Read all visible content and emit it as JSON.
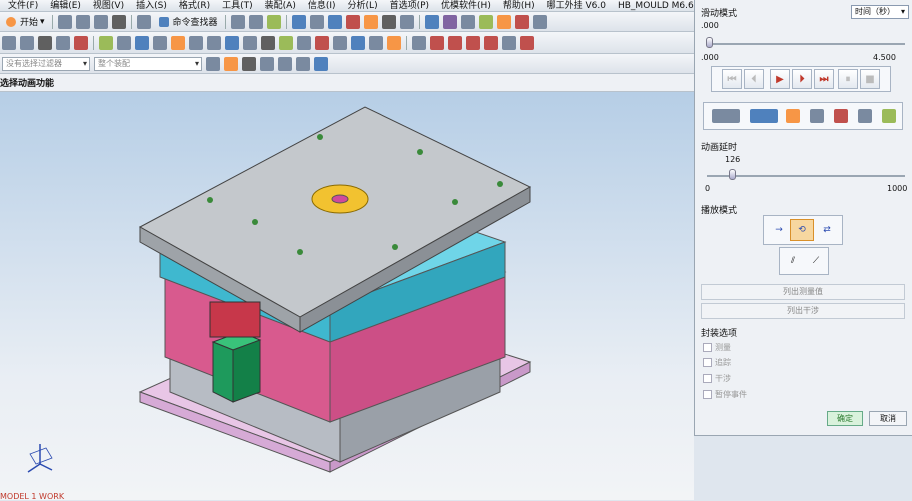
{
  "menu": [
    "文件(F)",
    "编辑(E)",
    "视图(V)",
    "插入(S)",
    "格式(R)",
    "工具(T)",
    "装配(A)",
    "信息(I)",
    "分析(L)",
    "首选项(P)",
    "优模软件(H)",
    "帮助(H)",
    "哪工外挂 V6.0",
    "HB_MOULD M6.6"
  ],
  "toolbar": {
    "start_label": "开始",
    "command_finder_label": "命令查找器"
  },
  "filter": {
    "selection_filter": "没有选择过滤器",
    "assembly": "整个装配"
  },
  "prompt": "选择动画功能",
  "status_bottom": "MODEL 1 WORK",
  "panel": {
    "slide_mode_label": "滑动模式",
    "time_mode_value": "时间（秒）",
    "slider_value": ".000",
    "slider_min": ".000",
    "slider_max": "4.500",
    "anim_delay_label": "动画延时",
    "delay_value": "126",
    "delay_min": "0",
    "delay_max": "1000",
    "playback_mode_label": "播放模式",
    "list_measure_label": "列出测量值",
    "list_interference_label": "列出干涉",
    "pack_options_label": "封装选项",
    "options": [
      "测量",
      "追踪",
      "干涉",
      "暂停事件"
    ],
    "ok_label": "确定",
    "cancel_label": "取消",
    "delay_fraction": 0.126,
    "accent": "#c0392b",
    "ok_color": "#2e7d32"
  }
}
